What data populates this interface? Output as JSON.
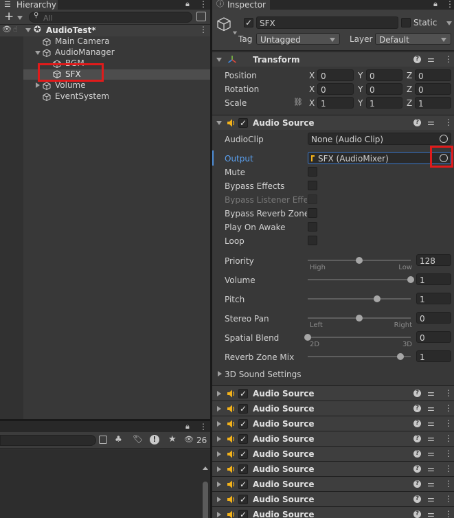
{
  "hierarchy": {
    "tab_label": "Hierarchy",
    "search_placeholder": "All",
    "scene_name": "AudioTest*",
    "items": [
      {
        "label": "Main Camera"
      },
      {
        "label": "AudioManager"
      },
      {
        "label": "BGM"
      },
      {
        "label": "SFX"
      },
      {
        "label": "Volume"
      },
      {
        "label": "EventSystem"
      }
    ]
  },
  "project_panel": {
    "visible_count": "26"
  },
  "inspector": {
    "tab_label": "Inspector",
    "object_name": "SFX",
    "static_label": "Static",
    "tag_label": "Tag",
    "tag_value": "Untagged",
    "layer_label": "Layer",
    "layer_value": "Default",
    "transform": {
      "title": "Transform",
      "rows": [
        {
          "label": "Position",
          "x": "0",
          "y": "0",
          "z": "0"
        },
        {
          "label": "Rotation",
          "x": "0",
          "y": "0",
          "z": "0"
        },
        {
          "label": "Scale",
          "x": "1",
          "y": "1",
          "z": "1"
        }
      ],
      "axis_x": "X",
      "axis_y": "Y",
      "axis_z": "Z"
    },
    "audio_source": {
      "title": "Audio Source",
      "audioclip_label": "AudioClip",
      "audioclip_value": "None (Audio Clip)",
      "output_label": "Output",
      "output_value": "SFX (AudioMixer)",
      "toggles": [
        {
          "label": "Mute",
          "disabled": false
        },
        {
          "label": "Bypass Effects",
          "disabled": false
        },
        {
          "label": "Bypass Listener Effects",
          "disabled": true
        },
        {
          "label": "Bypass Reverb Zones",
          "disabled": false
        },
        {
          "label": "Play On Awake",
          "disabled": false
        },
        {
          "label": "Loop",
          "disabled": false
        }
      ],
      "sliders": [
        {
          "label": "Priority",
          "value": "128",
          "fraction": 0.5,
          "min_label": "High",
          "max_label": "Low"
        },
        {
          "label": "Volume",
          "value": "1",
          "fraction": 1.0,
          "min_label": "",
          "max_label": ""
        },
        {
          "label": "Pitch",
          "value": "1",
          "fraction": 0.67,
          "min_label": "",
          "max_label": ""
        },
        {
          "label": "Stereo Pan",
          "value": "0",
          "fraction": 0.5,
          "min_label": "Left",
          "max_label": "Right"
        },
        {
          "label": "Spatial Blend",
          "value": "0",
          "fraction": 0.0,
          "min_label": "2D",
          "max_label": "3D"
        },
        {
          "label": "Reverb Zone Mix",
          "value": "1",
          "fraction": 0.9,
          "min_label": "",
          "max_label": ""
        }
      ],
      "sound_settings_label": "3D Sound Settings"
    },
    "collapsed_audio_sources": [
      "Audio Source",
      "Audio Source",
      "Audio Source",
      "Audio Source",
      "Audio Source",
      "Audio Source",
      "Audio Source",
      "Audio Source",
      "Audio Source"
    ]
  },
  "colors": {
    "highlight_red": "#e01b1b",
    "selection": "#4d4d4d",
    "output_link": "#5aa0f0"
  }
}
